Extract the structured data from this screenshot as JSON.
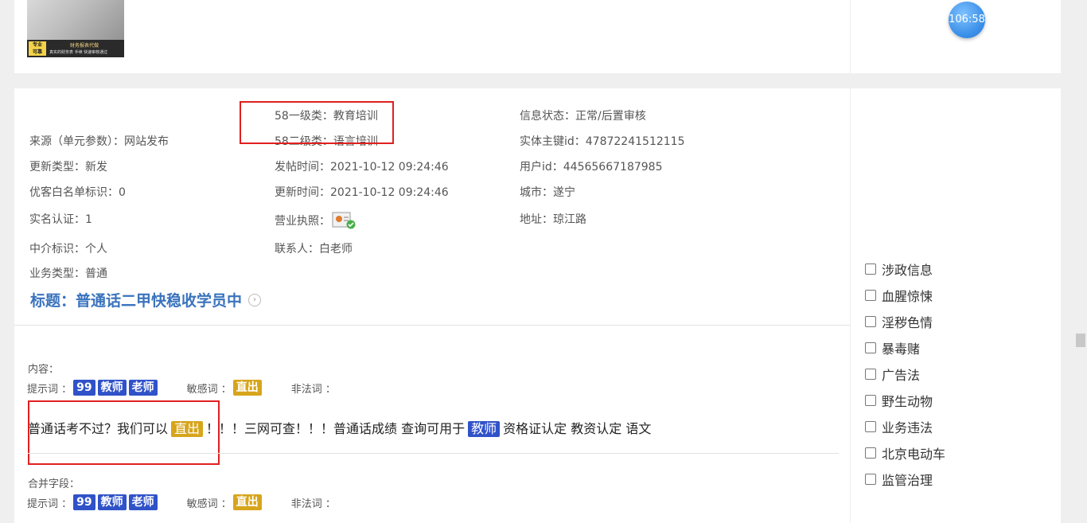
{
  "top": {
    "thumb_badge": "专业\n可靠",
    "thumb_text1": "财务报表代做",
    "thumb_text2": "真实的财务表 手续 快速审核通过",
    "timer": "106:58"
  },
  "fields": {
    "col1": [
      {
        "label": "来源（单元参数）：网站发布"
      },
      {
        "label": "更新类型：新发"
      },
      {
        "label": "优客白名单标识：0"
      },
      {
        "label": "实名认证：1"
      },
      {
        "label": "中介标识：个人"
      },
      {
        "label": "业务类型：普通"
      }
    ],
    "col2": [
      {
        "label": "58一级类：教育培训"
      },
      {
        "label": "58二级类：语言培训"
      },
      {
        "label": "发帖时间：2021-10-12 09:24:46"
      },
      {
        "label": "更新时间：2021-10-12 09:24:46"
      },
      {
        "label": "营业执照："
      },
      {
        "label": "联系人：白老师"
      }
    ],
    "col3": [
      {
        "label": "信息状态：正常/后置审核"
      },
      {
        "label": "实体主键id：47872241512115"
      },
      {
        "label": "用户id：44565667187985"
      },
      {
        "label": "城市：遂宁"
      },
      {
        "label": "地址：琼江路"
      }
    ]
  },
  "title": "标题：普通话二甲快稳收学员中",
  "content": {
    "label": "内容：",
    "hint_label": "提示词 ：",
    "sensitive_label": "敏感词 ：",
    "illegal_label": "非法词 ：",
    "hint_tags": [
      "99",
      "教师",
      "老师"
    ],
    "sensitive_tags": [
      "直出"
    ],
    "text_part1": "普通话考不过？我们可以",
    "text_tag1": "直出",
    "text_part2": "！！！三网可查！！！普通话成绩 查询可用于",
    "text_tag2": "教师",
    "text_part3": "资格证认定 教资认定 语文"
  },
  "merged": {
    "label": "合并字段：",
    "hint_label": "提示词 ：",
    "sensitive_label": "敏感词 ：",
    "illegal_label": "非法词 ：",
    "hint_tags": [
      "99",
      "教师",
      "老师"
    ],
    "sensitive_tags": [
      "直出"
    ]
  },
  "checkboxes": [
    "涉政信息",
    "血腥惊悚",
    "淫秽色情",
    "暴毒赌",
    "广告法",
    "野生动物",
    "业务违法",
    "北京电动车",
    "监管治理"
  ],
  "colors": {
    "tag_blue": "#3052c9",
    "tag_gold": "#d7a51c",
    "title": "#3a73bd",
    "highlight_box": "#e02020"
  }
}
